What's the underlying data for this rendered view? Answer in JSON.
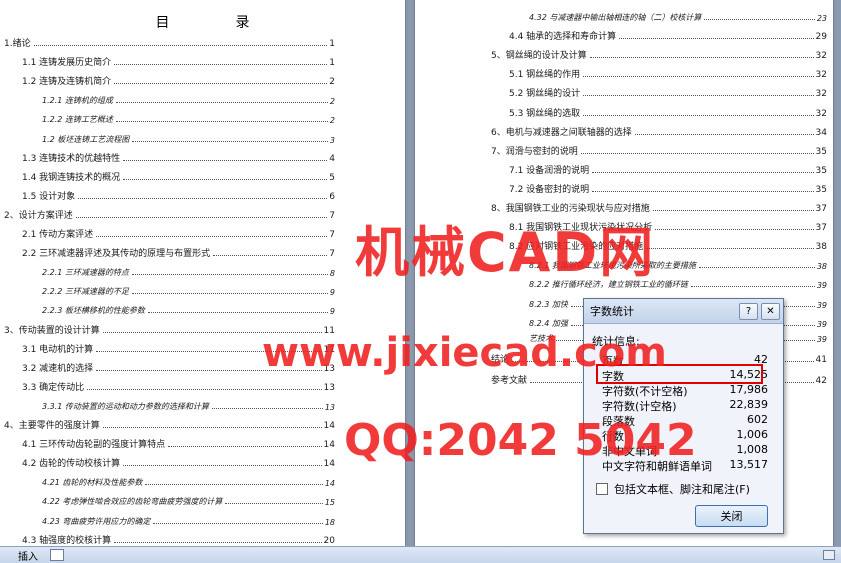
{
  "left_page": {
    "title": "目　录",
    "entries": [
      {
        "text": "1.绪论",
        "page": "1"
      },
      {
        "text": "1.1 连铸发展历史简介",
        "page": "1"
      },
      {
        "text": "1.2 连铸及连铸机简介",
        "page": "2"
      },
      {
        "text": "1.2.1 连铸机的组成",
        "page": "2"
      },
      {
        "text": "1.2.2 连铸工艺概述",
        "page": "2"
      },
      {
        "text": "1.2 板坯连铸工艺流程图",
        "page": "3"
      },
      {
        "text": "1.3 连铸技术的优越特性",
        "page": "4"
      },
      {
        "text": "1.4 我钢连铸技术的概况",
        "page": "5"
      },
      {
        "text": "1.5 设计对象",
        "page": "6"
      },
      {
        "text": "2、设计方案评述",
        "page": "7"
      },
      {
        "text": "2.1 传动方案评述",
        "page": "7"
      },
      {
        "text": "2.2 三环减速器评述及其传动的原理与布置形式",
        "page": "7"
      },
      {
        "text": "2.2.1 三环减速器的特点",
        "page": "8"
      },
      {
        "text": "2.2.2 三环减速器的不足",
        "page": "9"
      },
      {
        "text": "2.2.3 板坯横移机的性能参数",
        "page": "9"
      },
      {
        "text": "3、传动装置的设计计算",
        "page": "11"
      },
      {
        "text": "3.1 电动机的计算",
        "page": "11"
      },
      {
        "text": "3.2 减速机的选择",
        "page": "13"
      },
      {
        "text": "3.3 确定传动比",
        "page": "13"
      },
      {
        "text": "3.3.1 传动装置的运动和动力参数的选择和计算",
        "page": "13"
      },
      {
        "text": "4、主要零件的强度计算",
        "page": "14"
      },
      {
        "text": "4.1 三环传动齿轮副的强度计算特点",
        "page": "14"
      },
      {
        "text": "4.2 齿轮的传动校核计算",
        "page": "14"
      },
      {
        "text": "4.21 齿轮的材料及性能参数",
        "page": "14"
      },
      {
        "text": "4.22 考虑弹性啮合效应的齿轮弯曲疲劳强度的计算",
        "page": "15"
      },
      {
        "text": "4.23 弯曲疲劳许用应力的确定",
        "page": "18"
      },
      {
        "text": "4.3 轴强度的校核计算",
        "page": "20"
      }
    ]
  },
  "right_page": {
    "entries": [
      {
        "text": "4.32 与减速器中输出轴相连的轴（二）校核计算",
        "page": "23"
      },
      {
        "text": "4.4 轴承的选择和寿命计算",
        "page": "29"
      },
      {
        "text": "5、钢丝绳的设计及计算",
        "page": "32"
      },
      {
        "text": "5.1 钢丝绳的作用",
        "page": "32"
      },
      {
        "text": "5.2 钢丝绳的设计",
        "page": "32"
      },
      {
        "text": "5.3 钢丝绳的选取",
        "page": "32"
      },
      {
        "text": "6、电机与减速器之间联轴器的选择",
        "page": "34"
      },
      {
        "text": "7、润滑与密封的说明",
        "page": "35"
      },
      {
        "text": "7.1 设备润滑的说明",
        "page": "35"
      },
      {
        "text": "7.2 设备密封的说明",
        "page": "35"
      },
      {
        "text": "8、我国钢铁工业的污染现状与应对措施",
        "page": "37"
      },
      {
        "text": "8.1 我国钢铁工业现状污染状况分析",
        "page": "37"
      },
      {
        "text": "8.2 应对钢铁工业污染的应对措施",
        "page": "38"
      },
      {
        "text": "8.2.1 我国钢铁工业环境污染所采取的主要措施",
        "page": "38"
      },
      {
        "text": "8.2.2 推行循环经济，建立钢铁工业的循环链",
        "page": "39"
      },
      {
        "text": "8.2.3 加快",
        "page": "39"
      },
      {
        "text": "8.2.4 加强",
        "page": "39"
      },
      {
        "text": "艺技术",
        "page": "39"
      },
      {
        "text": "结论",
        "page": "41"
      },
      {
        "text": "参考文献",
        "page": "42"
      }
    ]
  },
  "dialog": {
    "title": "字数统计",
    "help": "?",
    "close_x": "✕",
    "group_label": "统计信息:",
    "stats": [
      {
        "label": "页数",
        "value": "42"
      },
      {
        "label": "字数",
        "value": "14,525"
      },
      {
        "label": "字符数(不计空格)",
        "value": "17,986"
      },
      {
        "label": "字符数(计空格)",
        "value": "22,839"
      },
      {
        "label": "段落数",
        "value": "602"
      },
      {
        "label": "行数",
        "value": "1,006"
      },
      {
        "label": "非中文单词",
        "value": "1,008"
      },
      {
        "label": "中文字符和朝鲜语单词",
        "value": "13,517"
      }
    ],
    "checkbox_label": "包括文本框、脚注和尾注(F)",
    "close_button": "关闭"
  },
  "watermark": {
    "line1": "机械CAD网",
    "line2": "www.jixiecad.com",
    "line3": "QQ:2042 5042",
    "color": "#f02020"
  },
  "statusbar": {
    "mode": "插入"
  }
}
